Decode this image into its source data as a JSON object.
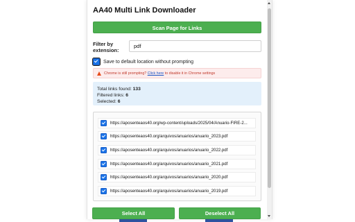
{
  "app": {
    "title": "AA40 Multi Link Downloader"
  },
  "toolbar": {
    "scan_label": "Scan Page for Links"
  },
  "filter": {
    "label": "Filter by extension:",
    "value": "pdf"
  },
  "save_option": {
    "checked": true,
    "label": "Save to default location without prompting"
  },
  "warning": {
    "prefix": "Chrome is still prompting? ",
    "link_text": "Click here",
    "suffix": " to disable it in Chrome settings"
  },
  "stats": {
    "total_label": "Total links found:",
    "total_value": "133",
    "filtered_label": "Filtered links:",
    "filtered_value": "6",
    "selected_label": "Selected:",
    "selected_value": "6"
  },
  "links": [
    {
      "checked": true,
      "url": "https://aposenteaos40.org/wp-content/uploads/2025/04/Anuario-FIRE-2..."
    },
    {
      "checked": true,
      "url": "https://aposenteaos40.org/arquivos/anuarios/anuario_2023.pdf"
    },
    {
      "checked": true,
      "url": "https://aposenteaos40.org/arquivos/anuarios/anuario_2022.pdf"
    },
    {
      "checked": true,
      "url": "https://aposenteaos40.org/arquivos/anuarios/anuario_2021.pdf"
    },
    {
      "checked": true,
      "url": "https://aposenteaos40.org/arquivos/anuarios/anuario_2020.pdf"
    },
    {
      "checked": true,
      "url": "https://aposenteaos40.org/arquivos/anuarios/anuario_2019.pdf"
    }
  ],
  "footer": {
    "select_all_label": "Select All",
    "deselect_all_label": "Deselect All"
  },
  "colors": {
    "accent_green": "#4caf50",
    "checkbox_blue": "#1a73e8",
    "warning_bg": "#fdecec",
    "warning_text": "#c0392b",
    "stats_bg": "#e3f0fb"
  },
  "icons": {
    "warning": "warning-icon",
    "checkbox": "checkbox-icon"
  }
}
